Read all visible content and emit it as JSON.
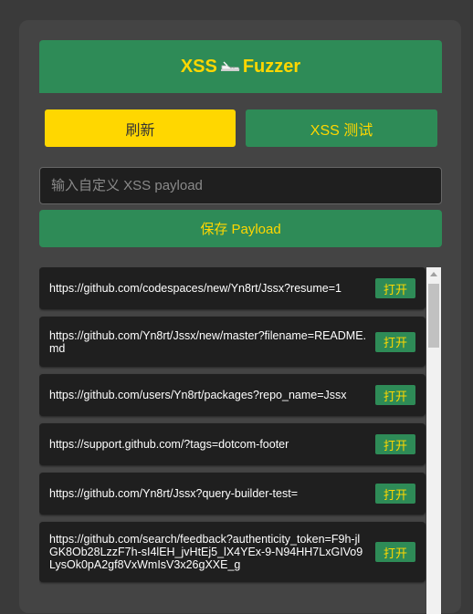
{
  "header": {
    "title_left": "XSS",
    "title_right": "Fuzzer",
    "emoji": "shoe-icon"
  },
  "actions": {
    "refresh_label": "刷新",
    "test_label": "XSS 测试"
  },
  "payload": {
    "placeholder": "输入自定义 XSS payload",
    "value": "",
    "save_label": "保存 Payload"
  },
  "urls": [
    {
      "url": "https://github.com/codespaces/new/Yn8rt/Jssx?resume=1",
      "action": "打开"
    },
    {
      "url": "https://github.com/Yn8rt/Jssx/new/master?filename=README.md",
      "action": "打开"
    },
    {
      "url": "https://github.com/users/Yn8rt/packages?repo_name=Jssx",
      "action": "打开"
    },
    {
      "url": "https://support.github.com/?tags=dotcom-footer",
      "action": "打开"
    },
    {
      "url": "https://github.com/Yn8rt/Jssx?query-builder-test=",
      "action": "打开"
    },
    {
      "url": "https://github.com/search/feedback?authenticity_token=F9h-jlGK8Ob28LzzF7h-sI4lEH_jvHtEj5_lX4YEx-9-N94HH7LxGIVo9LysOk0pA2gf8VxWmIsV3x26gXXE_g",
      "action": "打开"
    }
  ],
  "colors": {
    "accent_green": "#2e8b57",
    "accent_yellow": "#ffd700",
    "panel": "#444444",
    "background": "#3a3a3a"
  }
}
